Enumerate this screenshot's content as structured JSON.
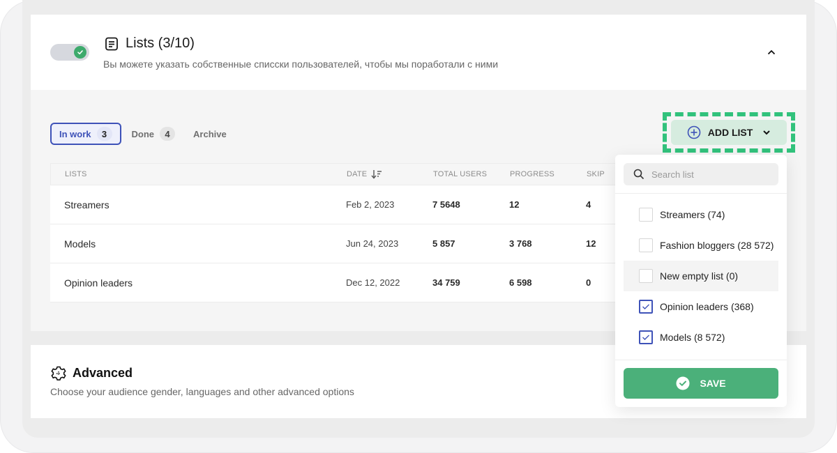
{
  "lists_section": {
    "title": "Lists (3/10)",
    "subtitle": "Вы можете указать собственные спиcски пользователей, чтобы мы поработали с ними",
    "toggle_on": true,
    "icon": "list-document-icon",
    "collapse_icon": "chevron-up-icon"
  },
  "tabs": [
    {
      "label": "In work",
      "count": "3",
      "active": true
    },
    {
      "label": "Done",
      "count": "4",
      "active": false
    },
    {
      "label": "Archive",
      "count": null,
      "active": false
    }
  ],
  "add_list": {
    "label": "ADD LIST",
    "icon": "plus-circle-icon",
    "chevron": "chevron-down-icon",
    "accent": "#32c27c"
  },
  "table": {
    "columns": [
      "LISTS",
      "DATE",
      "TOTAL USERS",
      "PROGRESS",
      "SKIP"
    ],
    "sort_column": "DATE",
    "rows": [
      {
        "name": "Streamers",
        "date": "Feb 2, 2023",
        "total": "7 5648",
        "progress": "12",
        "skip": "4"
      },
      {
        "name": "Models",
        "date": "Jun 24, 2023",
        "total": "5 857",
        "progress": "3 768",
        "skip": "12"
      },
      {
        "name": "Opinion leaders",
        "date": "Dec 12, 2022",
        "total": "34 759",
        "progress": "6 598",
        "skip": "0"
      }
    ]
  },
  "dropdown": {
    "search_placeholder": "Search list",
    "search_value": "",
    "options": [
      {
        "label": "Streamers (74)",
        "checked": false
      },
      {
        "label": "Fashion bloggers (28 572)",
        "checked": false
      },
      {
        "label": "New empty list (0)",
        "checked": false,
        "hovered": true
      },
      {
        "label": "Opinion leaders (368)",
        "checked": true
      },
      {
        "label": "Models (8 572)",
        "checked": true
      }
    ],
    "save_label": "SAVE",
    "save_color": "#4bb07a"
  },
  "advanced": {
    "title": "Advanced",
    "subtitle": "Choose your audience gender, languages and other advanced options",
    "icon": "gear-icon"
  }
}
